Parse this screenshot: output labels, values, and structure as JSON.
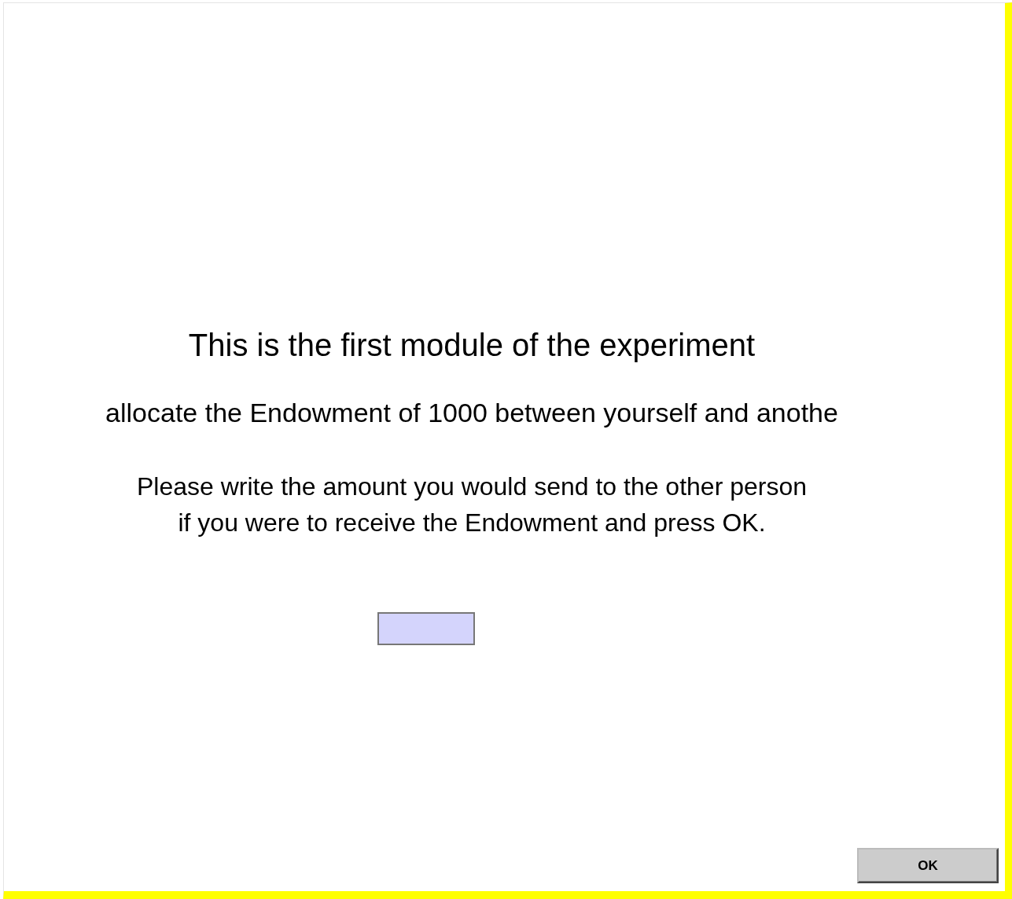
{
  "heading": "This is the first module of the experiment",
  "subheading": "allocate the Endowment of 1000 between yourself and anothe",
  "instruction": "Please write the amount you would send to the other person\nif you were to receive the Endowment and press OK.",
  "buttons": [
    {
      "label": "OK"
    }
  ]
}
